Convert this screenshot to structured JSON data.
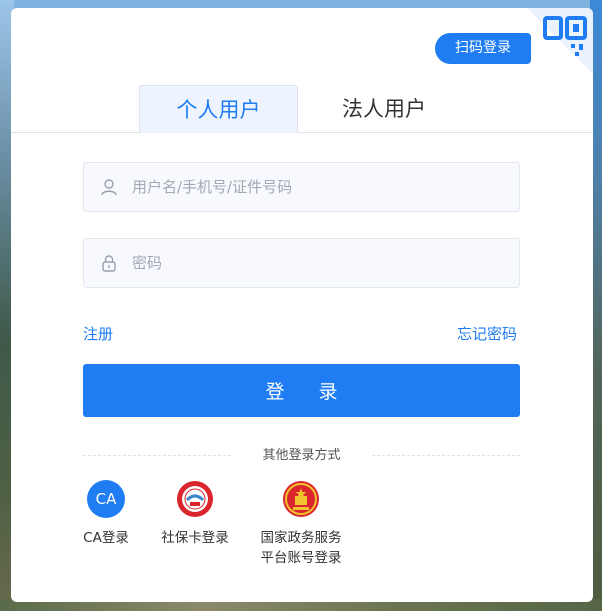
{
  "scan_login": {
    "label": "扫码登录"
  },
  "tabs": [
    {
      "label": "个人用户",
      "active": true
    },
    {
      "label": "法人用户",
      "active": false
    }
  ],
  "form": {
    "username": {
      "placeholder": "用户名/手机号/证件号码",
      "value": ""
    },
    "password": {
      "placeholder": "密码",
      "value": ""
    }
  },
  "links": {
    "register": "注册",
    "forgot": "忘记密码"
  },
  "login_button": {
    "label": "登 录"
  },
  "other": {
    "title": "其他登录方式",
    "methods": [
      {
        "icon_text": "CA",
        "label": "CA登录",
        "icon": "ca-icon"
      },
      {
        "label": "社保卡登录",
        "icon": "social-security-card-icon"
      },
      {
        "label_line1": "国家政务服务",
        "label_line2": "平台账号登录",
        "icon": "national-emblem-icon"
      }
    ]
  },
  "colors": {
    "accent": "#1f7cf2"
  }
}
